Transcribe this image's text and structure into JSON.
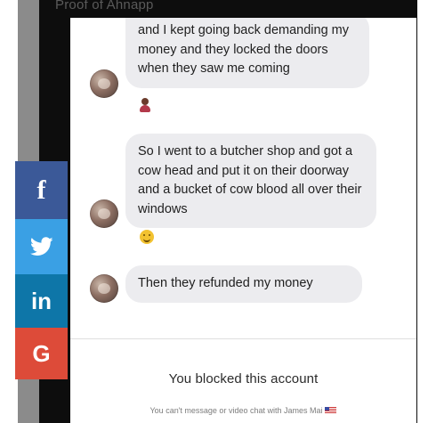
{
  "header": {
    "top_text": "Proof of Ahnapp"
  },
  "messages": [
    {
      "text": "and I kept going back demanding my money and they locked the doors when they saw me coming",
      "reaction_icon": "woman-emoji-icon"
    },
    {
      "text": "So I went to a butcher shop and got a cow head and put it on their doorway and a bucket of cow blood all over their windows",
      "reaction_icon": "smile-emoji-icon"
    },
    {
      "text": "Then they refunded my money"
    }
  ],
  "blocked": {
    "title": "You blocked this account",
    "subtitle": "You can't message or video chat with James Mai"
  },
  "share": {
    "facebook_label": "f",
    "linkedin_label": "in",
    "google_label": "G",
    "colors": {
      "facebook": "#3b5998",
      "twitter": "#3aa0e4",
      "linkedin": "#0e76a8",
      "google": "#dd4b39"
    }
  }
}
